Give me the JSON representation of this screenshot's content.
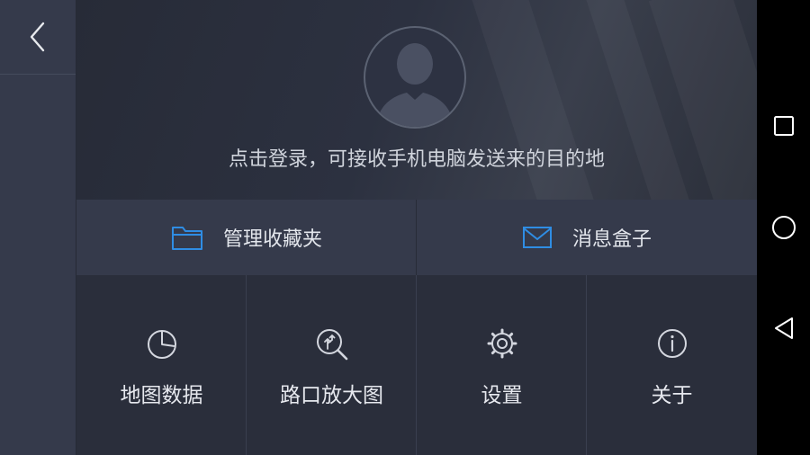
{
  "profile": {
    "login_prompt": "点击登录，可接收手机电脑发送来的目的地"
  },
  "quick_actions": [
    {
      "label": "管理收藏夹",
      "icon": "folder-icon"
    },
    {
      "label": "消息盒子",
      "icon": "mail-icon"
    }
  ],
  "grid": [
    {
      "label": "地图数据",
      "icon": "pie-chart-icon"
    },
    {
      "label": "路口放大图",
      "icon": "junction-zoom-icon"
    },
    {
      "label": "设置",
      "icon": "gear-icon"
    },
    {
      "label": "关于",
      "icon": "info-icon"
    }
  ],
  "system_nav": [
    "recents-icon",
    "home-icon",
    "back-triangle-icon"
  ],
  "colors": {
    "accent_blue": "#2f8de4",
    "panel": "#353a4b",
    "grid_bg": "#2a2e3b",
    "text": "#e3e6ec"
  }
}
